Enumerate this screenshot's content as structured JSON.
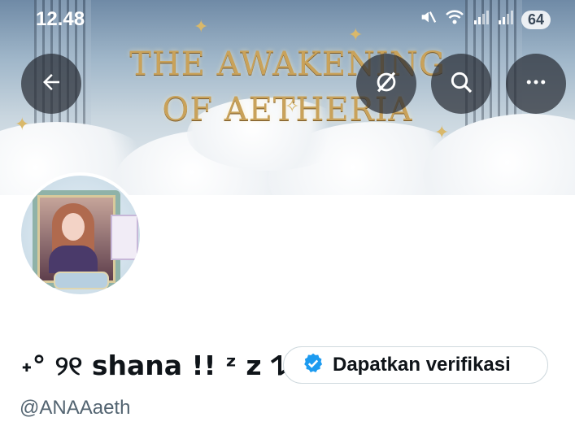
{
  "status_bar": {
    "time": "12.48",
    "battery": "64"
  },
  "banner": {
    "title_line1": "THE AWAKENING",
    "title_line2": "OF AETHERIA"
  },
  "header": {
    "back_icon": "arrow-left-icon",
    "grok_icon": "grok-icon",
    "search_icon": "search-icon",
    "more_icon": "more-icon"
  },
  "profile": {
    "display_name": "˖° ୨୧ shana !! ᶻ z 𐰁",
    "handle": "@ANAAaeth",
    "verify_label": "Dapatkan verifikasi"
  },
  "colors": {
    "verified_blue": "#1d9bf0",
    "text": "#0f1419",
    "muted": "#536471",
    "border": "#cfd9de"
  }
}
